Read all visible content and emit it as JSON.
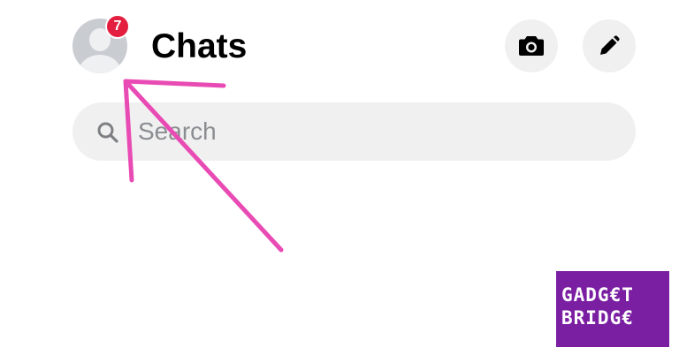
{
  "header": {
    "title": "Chats",
    "avatar_icon": "default-profile-avatar",
    "notification_count": "7",
    "camera_icon": "camera-icon",
    "compose_icon": "pencil-icon"
  },
  "search": {
    "placeholder": "Search",
    "value": "",
    "icon": "search-icon"
  },
  "overlay": {
    "annotation": "pink-arrow",
    "annotation_color": "#e94bb4"
  },
  "watermark": {
    "line1": "GADG€T",
    "line2": "BRIDG€",
    "background": "#7b1fa2"
  },
  "colors": {
    "badge": "#e41e3f",
    "button_bg": "#f0f0f0",
    "placeholder": "#8a8d91"
  }
}
